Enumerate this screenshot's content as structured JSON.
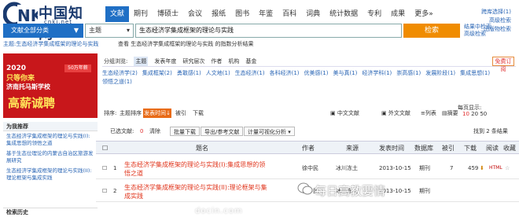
{
  "logo": {
    "text": "中国知网",
    "url": "cnki.net"
  },
  "tabs": [
    "文献",
    "期刊",
    "博硕士",
    "会议",
    "报纸",
    "图书",
    "年鉴",
    "百科",
    "词典",
    "统计数据",
    "专利",
    "成果",
    "更多»"
  ],
  "top_links": [
    "跨库选择(1)",
    "高级检索",
    "出版物检索"
  ],
  "search": {
    "scope": "文献全部分类",
    "field": "主题",
    "query": "生态经济学集成框架的理论与实践",
    "button": "检索",
    "side_links": [
      "结果中检索",
      "高级检索"
    ]
  },
  "breadcrumb": {
    "left": "主题:生态经济学集成框架的理论与实践",
    "right": "查看 生态经济学集成框架的理论与实践 的指数分析结果"
  },
  "banner": {
    "year": "2020",
    "l1": "只等你来",
    "l2": "济南托马斯学校",
    "l3": "高薪诚聘",
    "badge": "50万年薪"
  },
  "facets": {
    "tabs": [
      "分组浏览:",
      "主题",
      "发表年度",
      "研究层次",
      "作者",
      "机构",
      "基金"
    ],
    "subscribe": "免费订阅",
    "items": [
      "生态经济学(2)",
      "集成框架(2)",
      "勇敢感(1)",
      "人文地(1)",
      "生态经济(1)",
      "各科经济(1)",
      "优美感(1)",
      "美与真(1)",
      "经济学科(1)",
      "崇高感(1)",
      "发展阶段(1)",
      "集成思想(1)",
      "领悟之道(1)"
    ]
  },
  "recs": {
    "title": "为我推荐",
    "items": [
      "生态经济学集成框架的理论与实践(I):集成思想的领悟之道",
      "基于生态位理论的内蒙古自治区旅游发展研究",
      "生态经济学集成框架的理论与实践(II):理论框架与集成实践"
    ],
    "history": "检索历史"
  },
  "sortbar": {
    "label": "排序:",
    "options": [
      "主题排序",
      "发表时间",
      "被引",
      "下载"
    ],
    "active": "发表时间"
  },
  "view_switch": {
    "doc_cn": "中文文献",
    "doc_en": "外文文献",
    "list": "列表",
    "summary": "摘要",
    "per_page_label": "每页显示:",
    "per_page": [
      "10",
      "20",
      "50"
    ]
  },
  "toolbar": {
    "selected": "已选文献:",
    "selected_count": "0",
    "clear": "清除",
    "batch": "批量下载",
    "export": "导出/参考文献",
    "viz": "计量可视化分析",
    "found": "找到 2 条结果"
  },
  "table": {
    "headers": [
      "题名",
      "作者",
      "来源",
      "发表时间",
      "数据库",
      "被引",
      "下载",
      "阅读",
      "收藏"
    ],
    "rows": [
      {
        "no": "1",
        "title": "生态经济学集成框架的理论与实践(I):集成思想的领悟之道",
        "author": "徐中民",
        "source": "冰川冻土",
        "date": "2013-10-15",
        "db": "期刊",
        "cited": "7",
        "downloads": "459"
      },
      {
        "no": "2",
        "title": "生态经济学集成框架的理论与实践(II):理论框架与集成实践",
        "author": "徐中民",
        "source": "冰川冻土",
        "date": "2013-10-15",
        "db": "期刊",
        "cited": "",
        "downloads": ""
      }
    ]
  },
  "watermark": {
    "main": "每日高教要情",
    "sub": "docin.com"
  },
  "colors": {
    "blue": "#1f6fc5",
    "orange": "#f08c00",
    "red_title": "#e0331a"
  }
}
